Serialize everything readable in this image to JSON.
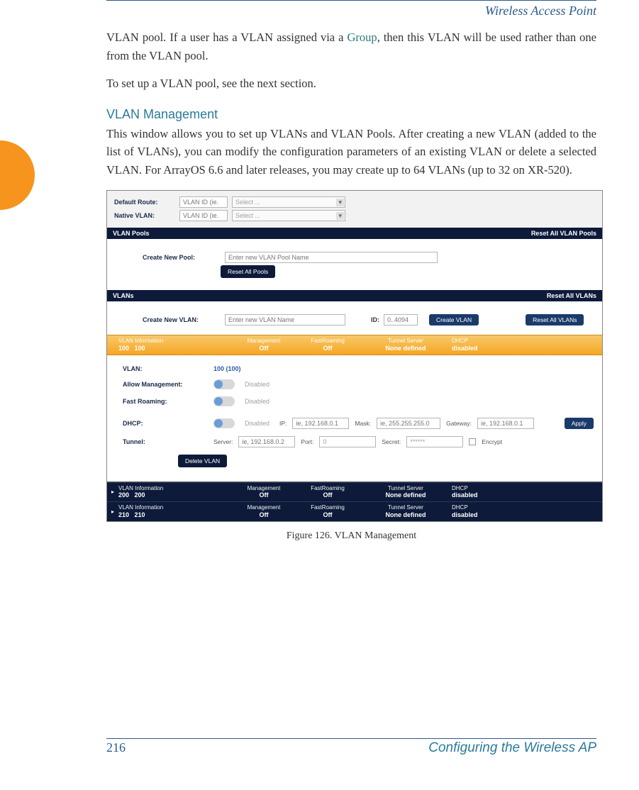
{
  "header": {
    "title": "Wireless Access Point"
  },
  "para1": {
    "pre": "VLAN pool. If a user has a VLAN assigned via a ",
    "link": "Group",
    "post": ", then this VLAN will be used rather than one from the VLAN pool."
  },
  "para2": "To set up a VLAN pool, see the next section.",
  "section_heading": "VLAN Management",
  "para3": "This window allows you to set up VLANs and VLAN Pools. After creating a new VLAN (added to the list of VLANs), you can modify the configuration parameters of an existing VLAN or delete a selected VLAN. For ArrayOS 6.6 and later releases, you may create up to 64 VLANs (up to 32 on XR-520).",
  "screenshot": {
    "top": {
      "default_route_label": "Default Route:",
      "native_vlan_label": "Native VLAN:",
      "vlan_id_placeholder": "VLAN ID (ie.",
      "select_placeholder": "Select ..."
    },
    "pools_bar": {
      "title": "VLAN Pools",
      "reset": "Reset All VLAN Pools"
    },
    "pools_body": {
      "create_label": "Create New Pool:",
      "create_placeholder": "Enter new VLAN Pool Name",
      "reset_btn": "Reset All Pools"
    },
    "vlans_bar": {
      "title": "VLANs",
      "reset": "Reset All VLANs"
    },
    "vlans_body": {
      "create_label": "Create New VLAN:",
      "name_placeholder": "Enter new VLAN Name",
      "id_label": "ID:",
      "id_placeholder": "0..4094",
      "create_btn": "Create VLAN",
      "reset_btn": "Reset All VLANs"
    },
    "col_headers": {
      "info": "VLAN Information",
      "mgmt": "Management",
      "roam": "FastRoaming",
      "tunnel": "Tunnel Server",
      "dhcp": "DHCP"
    },
    "vlan_rows": [
      {
        "id": "100",
        "name": "100",
        "mgmt": "Off",
        "roam": "Off",
        "tunnel": "None defined",
        "dhcp": "disabled"
      },
      {
        "id": "200",
        "name": "200",
        "mgmt": "Off",
        "roam": "Off",
        "tunnel": "None defined",
        "dhcp": "disabled"
      },
      {
        "id": "210",
        "name": "210",
        "mgmt": "Off",
        "roam": "Off",
        "tunnel": "None defined",
        "dhcp": "disabled"
      }
    ],
    "detail": {
      "vlan_label": "VLAN:",
      "vlan_value": "100   (100)",
      "allow_mgmt_label": "Allow Management:",
      "fast_roaming_label": "Fast Roaming:",
      "disabled_text": "Disabled",
      "dhcp_label": "DHCP:",
      "ip_label": "IP:",
      "ip_placeholder": "ie, 192.168.0.1",
      "mask_label": "Mask:",
      "mask_placeholder": "ie, 255.255.255.0",
      "gateway_label": "Gateway:",
      "gateway_placeholder": "ie, 192.168.0.1",
      "apply_btn": "Apply",
      "tunnel_label": "Tunnel:",
      "server_label": "Server:",
      "server_placeholder": "ie, 192.168.0.2",
      "port_label": "Port:",
      "port_value": "0",
      "secret_label": "Secret:",
      "secret_value": "******",
      "encrypt_label": "Encrypt",
      "delete_btn": "Delete VLAN"
    }
  },
  "caption": "Figure 126. VLAN Management",
  "footer": {
    "page": "216",
    "title": "Configuring the Wireless AP"
  }
}
